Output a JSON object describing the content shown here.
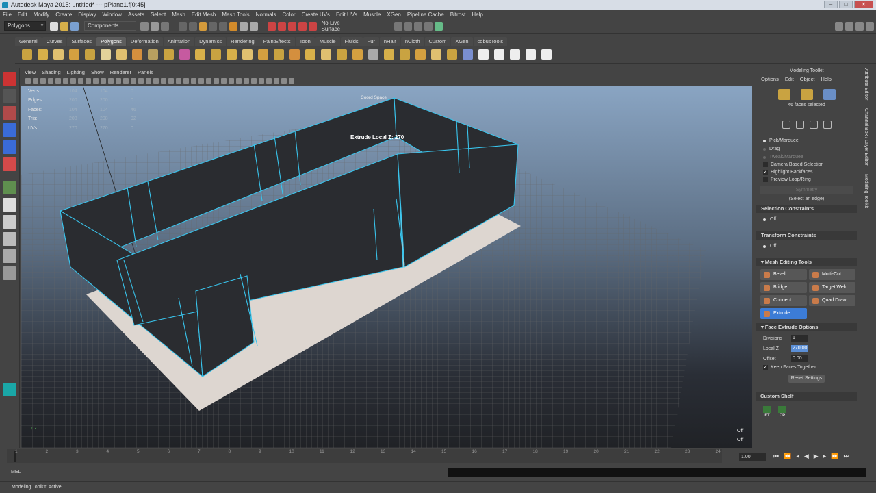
{
  "window": {
    "title": "Autodesk Maya 2015: untitled*   ---   pPlane1.f[0:45]"
  },
  "menubar": [
    "File",
    "Edit",
    "Modify",
    "Create",
    "Display",
    "Window",
    "Assets",
    "Select",
    "Mesh",
    "Edit Mesh",
    "Mesh Tools",
    "Normals",
    "Color",
    "Create UVs",
    "Edit UVs",
    "Muscle",
    "XGen",
    "Pipeline Cache",
    "Bifrost",
    "Help"
  ],
  "status": {
    "menuset": "Polygons",
    "selection_mode": "Components",
    "live_surface": "No Live Surface"
  },
  "shelf_tabs": [
    "General",
    "Curves",
    "Surfaces",
    "Polygons",
    "Deformation",
    "Animation",
    "Dynamics",
    "Rendering",
    "PaintEffects",
    "Toon",
    "Muscle",
    "Fluids",
    "Fur",
    "nHair",
    "nCloth",
    "Custom",
    "XGen",
    "cobusTools"
  ],
  "active_shelf_tab": "Polygons",
  "panel_menu": [
    "View",
    "Shading",
    "Lighting",
    "Show",
    "Renderer",
    "Panels"
  ],
  "hud": [
    {
      "label": "Verts:",
      "v1": "104",
      "v2": "104",
      "v3": "0"
    },
    {
      "label": "Edges:",
      "v1": "200",
      "v2": "200",
      "v3": "0"
    },
    {
      "label": "Faces:",
      "v1": "104",
      "v2": "104",
      "v3": "46"
    },
    {
      "label": "Tris:",
      "v1": "208",
      "v2": "208",
      "v3": "92"
    },
    {
      "label": "UVs:",
      "v1": "270",
      "v2": "270",
      "v3": "0"
    }
  ],
  "viewport": {
    "coord_space": "Coord Space",
    "extrude_label": "Extrude Local Z: 270",
    "off1": "Off",
    "off2": "Off"
  },
  "modeling_toolkit": {
    "title": "Modeling Toolkit",
    "menu": [
      "Options",
      "Edit",
      "Object",
      "Help"
    ],
    "faces_selected": "46 faces selected",
    "pick": "Pick/Marquee",
    "drag": "Drag",
    "tweak": "Tweak/Marquee",
    "camera_based": "Camera Based Selection",
    "highlight_backfaces": "Highlight Backfaces",
    "preview_loop": "Preview Loop/Ring",
    "symmetry": "Symmetry",
    "select_edge_hint": "(Select an edge)",
    "selection_constraints": "Selection Constraints",
    "sel_off": "Off",
    "transform_constraints": "Transform Constraints",
    "trans_off": "Off",
    "mesh_editing_tools": "Mesh Editing Tools",
    "tools": [
      "Bevel",
      "Multi-Cut",
      "Bridge",
      "Target Weld",
      "Connect",
      "Quad Draw",
      "Extrude"
    ],
    "face_extrude_options": "Face Extrude Options",
    "divisions_label": "Divisions",
    "divisions": "1",
    "localz_label": "Local Z",
    "localz": "270.00",
    "offset_label": "Offset",
    "offset": "0.00",
    "keep_faces": "Keep Faces Together",
    "reset": "Reset Settings",
    "custom_shelf": "Custom Shelf",
    "custom_icons": [
      "FT",
      "CP"
    ]
  },
  "side_tabs": [
    "Attribute Editor",
    "Channel Box / Layer Editor",
    "Modeling Toolkit"
  ],
  "timeline": {
    "ticks": [
      "1",
      "2",
      "3",
      "4",
      "5",
      "6",
      "7",
      "8",
      "9",
      "10",
      "11",
      "12",
      "13",
      "14",
      "15",
      "16",
      "17",
      "18",
      "19",
      "20",
      "21",
      "22",
      "23",
      "24"
    ],
    "start": "1.00"
  },
  "cmd": {
    "label": "MEL"
  },
  "help": {
    "text": "Modeling Toolkit: Active"
  }
}
